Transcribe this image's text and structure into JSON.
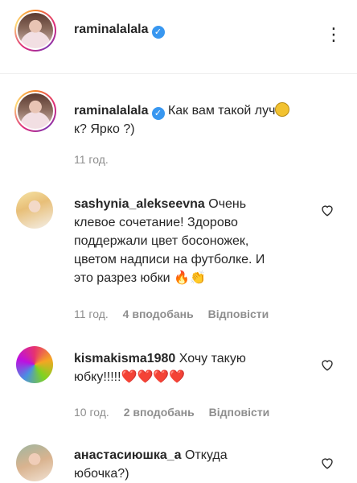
{
  "header": {
    "username": "raminalalala",
    "more_icon": "⋮"
  },
  "caption": {
    "username": "raminalalala",
    "text_line1": "Как вам такой луч",
    "text_line2": "к? Ярко ?)",
    "time": "11 год."
  },
  "comments": [
    {
      "username": "sashynia_alekseevna",
      "line1": "Очень",
      "line2": "клевое сочетание! Здорово",
      "line3": "поддержали цвет босоножек,",
      "line4": "цветом надписи на футболке. И",
      "line5": "это разрез юбки 🔥👏",
      "time": "11 год.",
      "likes": "4 вподобань",
      "reply": "Відповісти"
    },
    {
      "username": "kismakisma1980",
      "line1": "Хочу такую",
      "line2": "юбку!!!!!❤️❤️❤️❤️",
      "time": "10 год.",
      "likes": "2 вподобань",
      "reply": "Відповісти"
    },
    {
      "username": "анастасиюшка_а",
      "line1": "Откуда",
      "line2": "юбочка?)",
      "time": "",
      "likes": "",
      "reply": ""
    }
  ]
}
